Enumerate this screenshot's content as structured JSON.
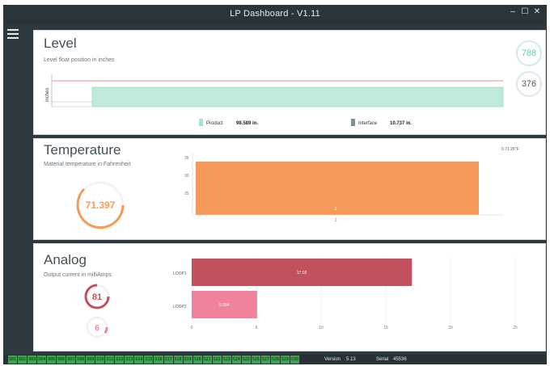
{
  "window": {
    "title": "LP Dashboard - V1.11",
    "minimize": "–",
    "restore": "☐",
    "close": "✕"
  },
  "menu": {
    "icon": "hamburger-menu-icon"
  },
  "level": {
    "title": "Level",
    "subtitle": "Level float position in inches",
    "axis_unit": "inches",
    "badge_product": "788",
    "badge_interface": "376",
    "legend": [
      {
        "name": "Product",
        "value": "98.589 in.",
        "color": "#a8e0cc"
      },
      {
        "name": "Interface",
        "value": "10.737 in.",
        "color": "#7c8f95"
      }
    ],
    "series_colors": {
      "product": "#bfe9d9",
      "limit": "#f4a3a3"
    }
  },
  "temperature": {
    "title": "Temperature",
    "subtitle": "Material temperature in Fahrenheit",
    "gauge_value": "71.397",
    "corner_label": "0.71 26°F",
    "bar_label": "2",
    "color": "#f59a5b"
  },
  "analog": {
    "title": "Analog",
    "subtitle": "Output current in milliAmps",
    "gauge1": "81",
    "gauge2": "6",
    "colors": {
      "loop1": "#c2505f",
      "loop2": "#f0829b"
    }
  },
  "status": {
    "chips": [
      "S01",
      "S02",
      "S03",
      "S04",
      "S05",
      "S06",
      "S07",
      "S08",
      "S09",
      "S10",
      "S11",
      "S12",
      "S13",
      "S14",
      "S15",
      "S16",
      "S17",
      "S18",
      "S19",
      "S20",
      "S21",
      "S22",
      "S23",
      "S24",
      "S25",
      "S26",
      "S27",
      "S28",
      "S29",
      "S30"
    ],
    "version_label": "Version",
    "version": "5.13",
    "serial_label": "Serial",
    "serial": "45536"
  },
  "chart_data": [
    {
      "type": "area",
      "series": [
        {
          "name": "Product",
          "values": [
            98.589
          ]
        },
        {
          "name": "Interface",
          "values": [
            10.737
          ]
        }
      ],
      "ylabel": "inches"
    },
    {
      "type": "bar",
      "categories": [
        "1"
      ],
      "values": [
        71.397
      ],
      "yticks": [
        "35",
        "30",
        "25"
      ]
    },
    {
      "type": "bar",
      "orientation": "horizontal",
      "categories": [
        "LOOP1",
        "LOOP2"
      ],
      "values": [
        17.02,
        5.054
      ],
      "value_labels": [
        "17.02",
        "5.054"
      ],
      "xticks": [
        "0",
        "5",
        "10",
        "15",
        "20",
        "25"
      ],
      "xlim": [
        0,
        25
      ]
    }
  ]
}
